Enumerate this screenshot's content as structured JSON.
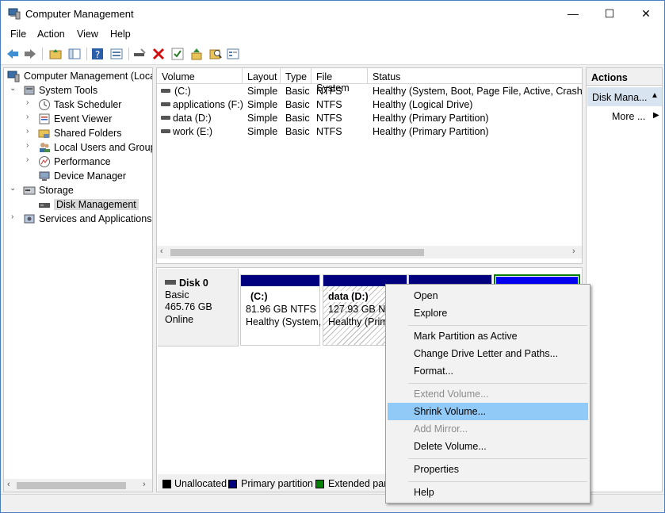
{
  "window": {
    "title": "Computer Management",
    "minimize": "—",
    "maximize": "☐",
    "close": "✕"
  },
  "menu": [
    "File",
    "Action",
    "View",
    "Help"
  ],
  "tree": {
    "root": "Computer Management (Local",
    "system_tools": "System Tools",
    "task_scheduler": "Task Scheduler",
    "event_viewer": "Event Viewer",
    "shared_folders": "Shared Folders",
    "local_users": "Local Users and Groups",
    "performance": "Performance",
    "device_manager": "Device Manager",
    "storage": "Storage",
    "disk_management": "Disk Management",
    "services": "Services and Applications"
  },
  "volumes": {
    "headers": [
      "Volume",
      "Layout",
      "Type",
      "File System",
      "Status"
    ],
    "rows": [
      [
        "(C:)",
        "Simple",
        "Basic",
        "NTFS",
        "Healthy (System, Boot, Page File, Active, Crash Du"
      ],
      [
        "applications (F:)",
        "Simple",
        "Basic",
        "NTFS",
        "Healthy (Logical Drive)"
      ],
      [
        "data (D:)",
        "Simple",
        "Basic",
        "NTFS",
        "Healthy (Primary Partition)"
      ],
      [
        "work (E:)",
        "Simple",
        "Basic",
        "NTFS",
        "Healthy (Primary Partition)"
      ]
    ]
  },
  "disk": {
    "name": "Disk 0",
    "type": "Basic",
    "size": "465.76 GB",
    "state": "Online",
    "partitions": [
      {
        "name": "(C:)",
        "size": "81.96 GB NTFS",
        "status": "Healthy (System,"
      },
      {
        "name": "data  (D:)",
        "size": "127.93 GB NTFS",
        "status": "Healthy (Prim"
      }
    ]
  },
  "legend": [
    "Unallocated",
    "Primary partition",
    "Extended part"
  ],
  "actions": {
    "header": "Actions",
    "sub": "Disk Mana...",
    "more": "More ..."
  },
  "context_menu": {
    "open": "Open",
    "explore": "Explore",
    "mark_active": "Mark Partition as Active",
    "change_letter": "Change Drive Letter and Paths...",
    "format": "Format...",
    "extend": "Extend Volume...",
    "shrink": "Shrink Volume...",
    "add_mirror": "Add Mirror...",
    "delete": "Delete Volume...",
    "properties": "Properties",
    "help": "Help"
  },
  "colors": {
    "primary": "#00007f",
    "extended": "#008000",
    "unallocated": "#000000",
    "highlight": "#91c9f7"
  }
}
